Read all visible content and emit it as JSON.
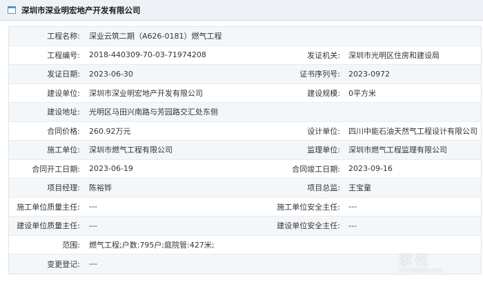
{
  "header": {
    "title": "深圳市深业明宏地产开发有限公司"
  },
  "labels": {
    "project_name": "工程名称:",
    "project_code": "工程编号:",
    "issuer": "发证机关:",
    "issue_date": "发证日期:",
    "cert_no": "证书序列号:",
    "builder": "建设单位:",
    "scale": "建设规模:",
    "address": "建设地址:",
    "price": "合同价格:",
    "designer": "设计单位:",
    "contractor": "施工单位:",
    "supervisor": "监理单位:",
    "start_date": "合同开工日期:",
    "end_date": "合同竣工日期:",
    "manager": "项目经理:",
    "chief": "项目总监:",
    "ct_quality": "施工单位质量主任:",
    "ct_safety": "施工单位安全主任:",
    "bd_quality": "建设单位质量主任:",
    "bd_safety": "建设单位安全主任:",
    "scope": "范围:",
    "change": "变更登记:"
  },
  "values": {
    "project_name": "深业云筑二期（A626-0181）燃气工程",
    "project_code": "2018-440309-70-03-71974208",
    "issuer": "深圳市光明区住房和建设局",
    "issue_date": "2023-06-30",
    "cert_no": "2023-0972",
    "builder": "深圳市深业明宏地产开发有限公司",
    "scale": "0平方米",
    "address": "光明区马田兴南路与芳园路交汇处东侧",
    "price": "260.92万元",
    "designer": "四川中能石油天然气工程设计有限公司",
    "contractor": "深圳市燃气工程有限公司",
    "supervisor": "深圳市燃气工程监理有限公司",
    "start_date": "2023-06-19",
    "end_date": "2023-09-16",
    "manager": "陈裕铧",
    "chief": "王宝童",
    "ct_quality": "---",
    "ct_safety": "---",
    "bd_quality": "---",
    "bd_safety": "---",
    "scope": "燃气工程;户数:795户;庭院管:427米;",
    "change": "---"
  },
  "watermark": {
    "text": "家在",
    "url": "www.szhome.com"
  }
}
